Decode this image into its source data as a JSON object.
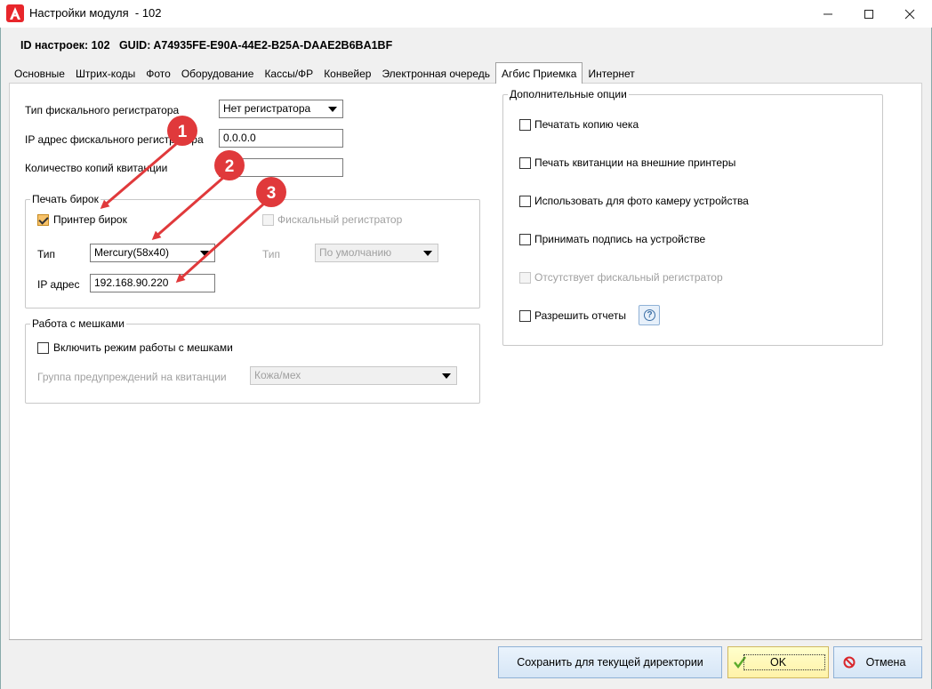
{
  "window": {
    "title": "Настройки модуля  - 102",
    "minimize_label": "—",
    "maximize_label": "☐",
    "close_label": "✕"
  },
  "header": {
    "id_line": "ID настроек: 102   GUID: A74935FE-E90A-44E2-B25A-DAAE2B6BA1BF"
  },
  "tabs": [
    {
      "label": "Основные"
    },
    {
      "label": "Штрих-коды"
    },
    {
      "label": "Фото"
    },
    {
      "label": "Оборудование"
    },
    {
      "label": "Кассы/ФР"
    },
    {
      "label": "Конвейер"
    },
    {
      "label": "Электронная очередь"
    },
    {
      "label": "Агбис Приемка",
      "active": true
    },
    {
      "label": "Интернет"
    }
  ],
  "fiscal": {
    "type_label": "Тип фискального регистратора",
    "type_value": "Нет регистратора",
    "ip_label": "IP адрес фискального регистратора",
    "ip_value": "0.0.0.0",
    "copies_label": "Количество копий квитанции",
    "copies_value": ""
  },
  "tag_print": {
    "title": "Печать бирок",
    "printer_label": "Принтер бирок",
    "printer_checked": true,
    "fiscal_label": "Фискальный регистратор",
    "type_label": "Тип",
    "type_value": "Mercury(58x40)",
    "ip_label": "IP адрес",
    "ip_value": "192.168.90.220",
    "fiscal_type_label": "Тип",
    "fiscal_type_value": "По умолчанию"
  },
  "bags": {
    "title": "Работа с мешками",
    "enable_label": "Включить режим работы с мешками",
    "warn_group_label": "Группа предупреждений на квитанции",
    "warn_group_value": "Кожа/мех"
  },
  "options": {
    "title": "Дополнительные опции",
    "items": [
      {
        "label": "Печатать копию чека"
      },
      {
        "label": "Печать квитанции на внешние принтеры"
      },
      {
        "label": "Использовать для фото камеру устройства"
      },
      {
        "label": "Принимать подпись на устройстве"
      },
      {
        "label": "Отсутствует фискальный регистратор"
      },
      {
        "label": "Разрешить отчеты"
      }
    ],
    "help_label": "?"
  },
  "footer": {
    "save_dir_label": "Сохранить для текущей директории",
    "ok_label": "OK",
    "cancel_label": "Отмена"
  },
  "annotations": [
    {
      "label": "1"
    },
    {
      "label": "2"
    },
    {
      "label": "3"
    }
  ],
  "colors": {
    "annotation_red": "#e0393b",
    "logo_red": "#e8262b"
  }
}
